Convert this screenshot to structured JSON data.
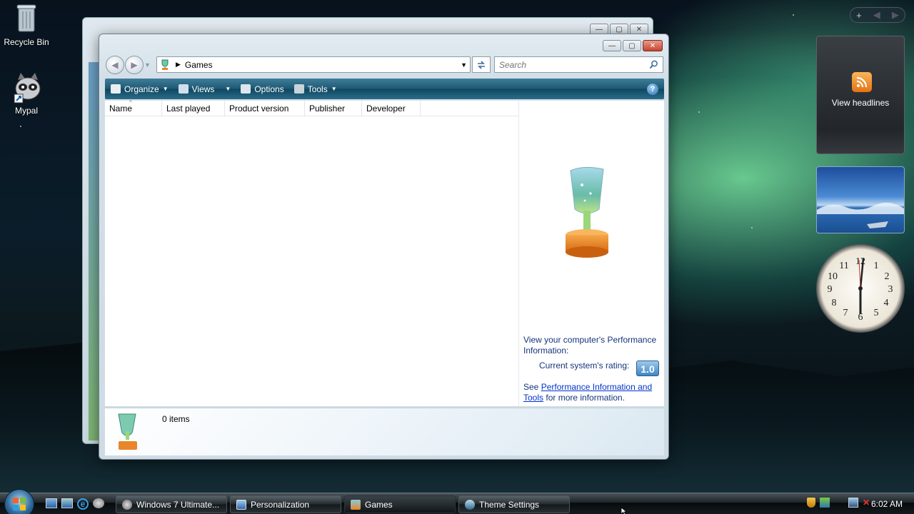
{
  "desktop": {
    "icons": [
      {
        "label": "Recycle Bin",
        "icon": "recycle-bin-icon"
      },
      {
        "label": "Mypal",
        "icon": "raccoon-shortcut-icon"
      }
    ]
  },
  "games_window": {
    "address": "Games",
    "search_placeholder": "Search",
    "toolbar": {
      "organize": "Organize",
      "views": "Views",
      "options": "Options",
      "tools": "Tools"
    },
    "columns": [
      "Name",
      "Last played",
      "Product version",
      "Publisher",
      "Developer"
    ],
    "preview": {
      "perf_text": "View your computer's Performance Information:",
      "rating_label": "Current system's rating:",
      "rating_value": "1.0",
      "see_prefix": "See",
      "link_text": "Performance Information and Tools",
      "see_suffix": "for more information."
    },
    "status": "0 items"
  },
  "gadgets": {
    "feed_label": "View headlines"
  },
  "taskbar": {
    "items": [
      "Windows 7 Ultimate...",
      "Personalization",
      "Games",
      "Theme Settings"
    ],
    "clock": "6:02 AM"
  },
  "colors": {
    "accent": "#1e5873",
    "link": "#0033cc",
    "rss": "#f08a24"
  }
}
